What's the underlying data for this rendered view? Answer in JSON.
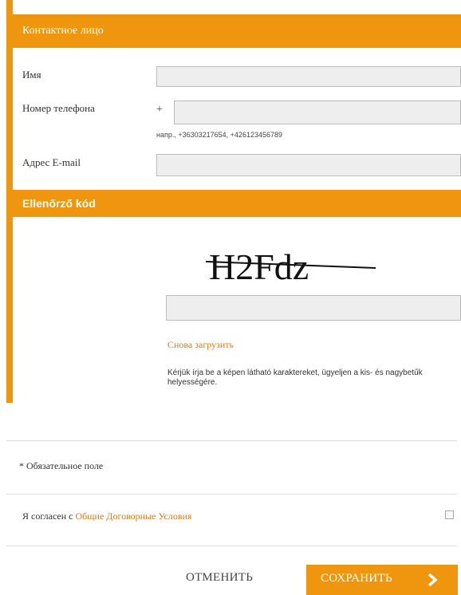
{
  "contact_section": {
    "title": "Контактное лицо",
    "name_label": "Имя",
    "phone_label": "Номер телефона",
    "phone_prefix": "+",
    "phone_hint": "напр., +36303217654, +426123456789",
    "email_label": "Адрес E-mail"
  },
  "captcha_section": {
    "title": "Ellenőrző kód",
    "captcha_text": "H2Fdz",
    "reload_label": "Снова загрузить",
    "help_text": "Kérjük írja be a képen látható karaktereket, ügyeljen a kis- és nagybetűk helyességére."
  },
  "footer": {
    "required_note": "* Обязательное поле",
    "agree_prefix": "Я согласен с ",
    "agree_link": "Общие Договорные Условия",
    "cancel_label": "ОТМЕНИТЬ",
    "save_label": "СОХРАНИТЬ"
  },
  "colors": {
    "accent": "#f0960e",
    "link": "#e07b13",
    "field_bg": "#eeeeee"
  }
}
